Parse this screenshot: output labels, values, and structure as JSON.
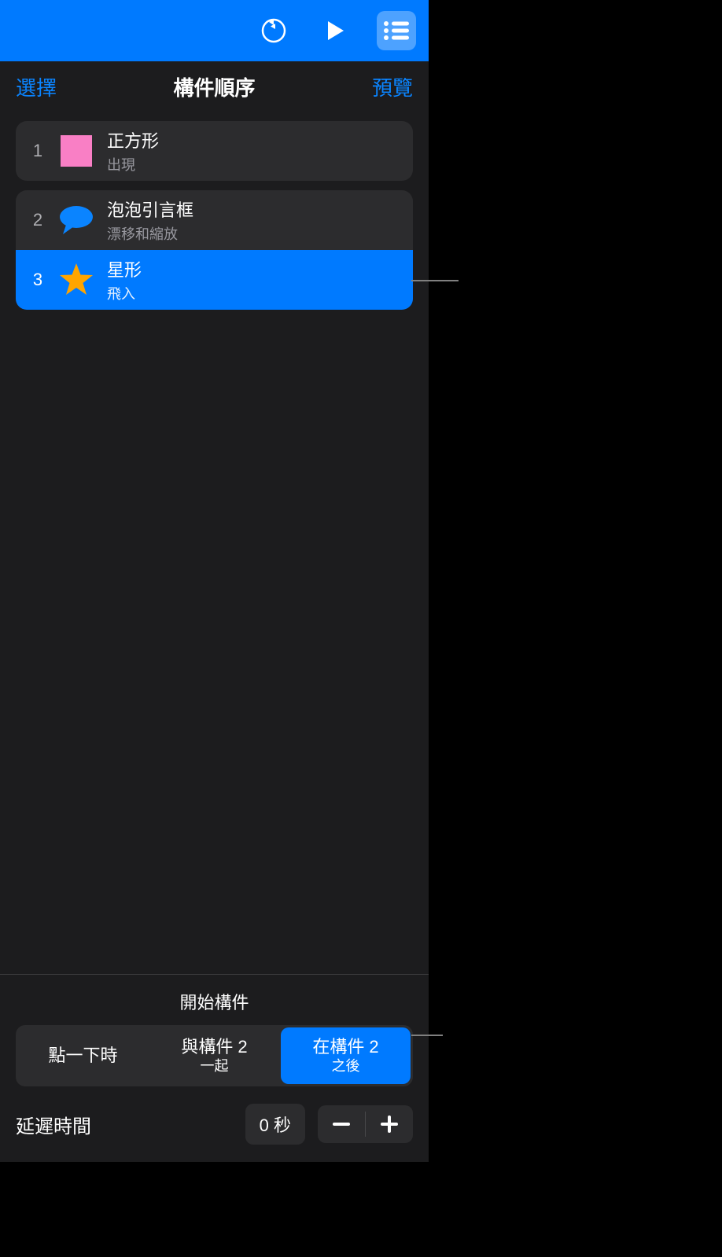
{
  "header": {
    "select_label": "選擇",
    "title": "構件順序",
    "preview_label": "預覽"
  },
  "builds": [
    {
      "num": "1",
      "title": "正方形",
      "subtitle": "出現",
      "icon": "square-pink",
      "selected": false
    },
    {
      "num": "2",
      "title": "泡泡引言框",
      "subtitle": "漂移和縮放",
      "icon": "speech-bubble-blue",
      "selected": false
    },
    {
      "num": "3",
      "title": "星形",
      "subtitle": "飛入",
      "icon": "star-orange",
      "selected": true
    }
  ],
  "start": {
    "label": "開始構件",
    "options": [
      {
        "line1": "點一下時",
        "line2": "",
        "selected": false
      },
      {
        "line1": "與構件 2",
        "line2": "一起",
        "selected": false
      },
      {
        "line1": "在構件 2",
        "line2": "之後",
        "selected": true
      }
    ]
  },
  "delay": {
    "label": "延遲時間",
    "value": "0 秒"
  }
}
